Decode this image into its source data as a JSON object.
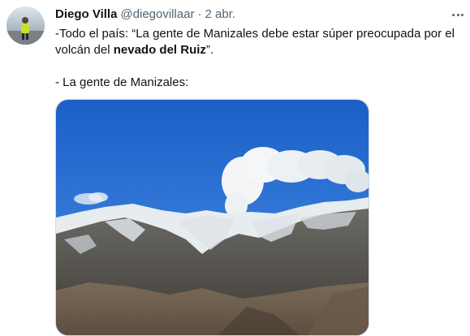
{
  "tweet": {
    "author_name": "Diego Villa",
    "author_handle": "@diegovillaar",
    "separator": "·",
    "date": "2 abr.",
    "text_line1_prefix": "-Todo el país: “La gente de Manizales debe estar súper preocupada por el volcán del ",
    "text_line1_bold": "nevado del Ruiz",
    "text_line1_suffix": "”.",
    "text_line2": "- La gente de Manizales:"
  },
  "icons": {
    "more": "more-options-icon"
  },
  "colors": {
    "text_primary": "#0f1419",
    "text_secondary": "#536471",
    "border": "#cfd9de",
    "sky": "#1f6fd6"
  }
}
